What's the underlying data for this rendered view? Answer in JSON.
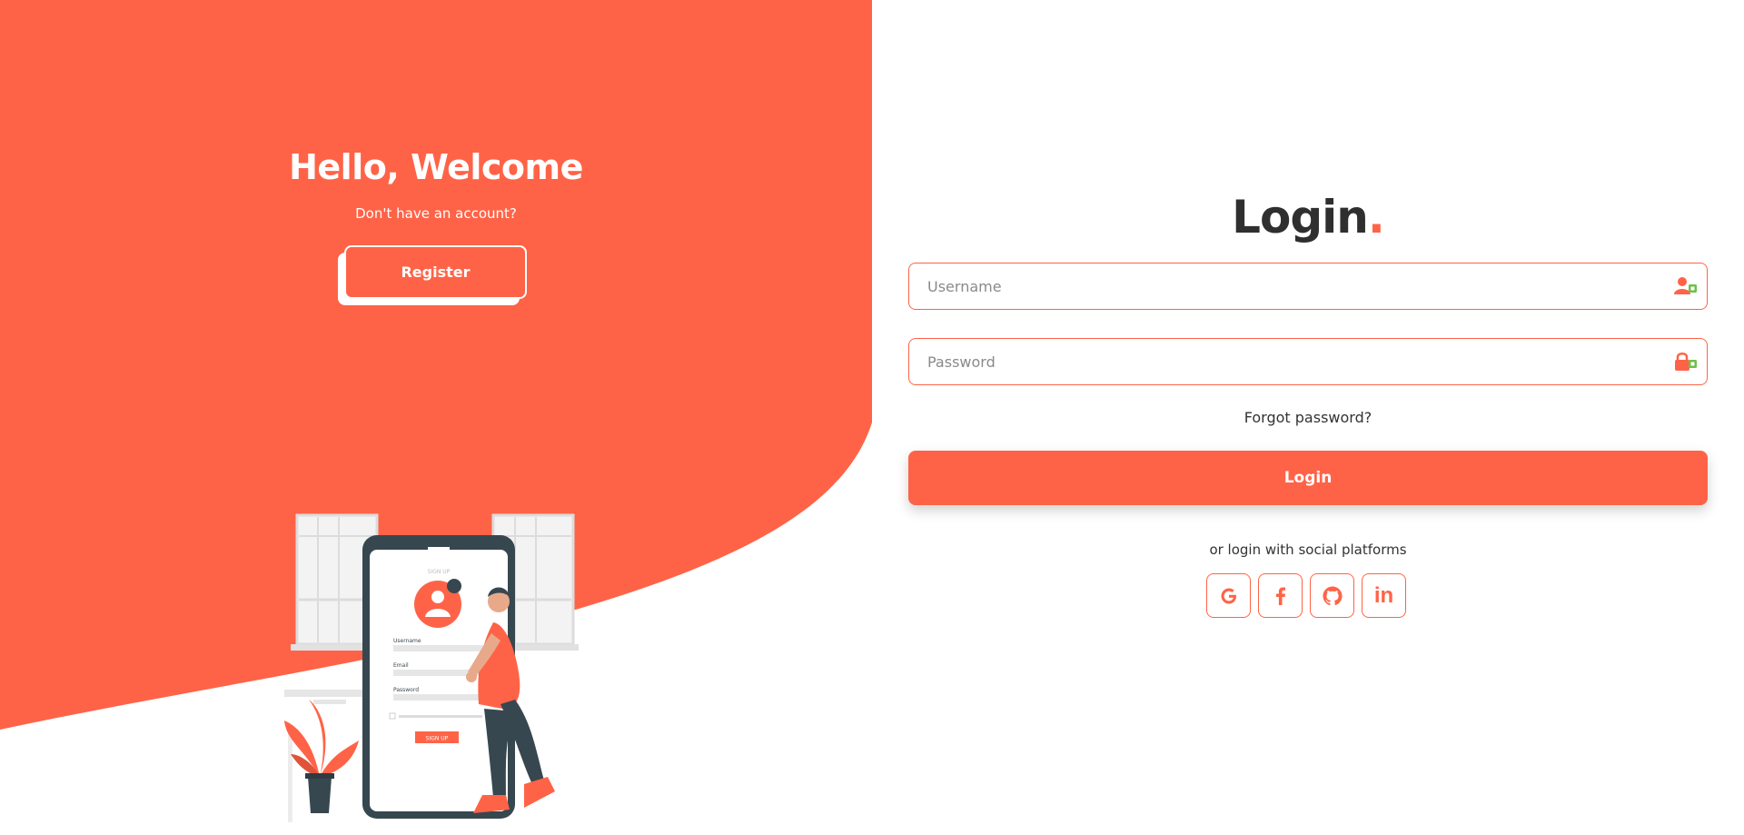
{
  "colors": {
    "accent": "#ff6347",
    "white": "#ffffff",
    "dark": "#2f2f2f"
  },
  "left": {
    "heading": "Hello, Welcome",
    "subtext": "Don't have an account?",
    "register_label": "Register",
    "illustration": {
      "phone_screen_title": "SIGN UP",
      "field_username": "Username",
      "field_email": "Email",
      "field_password": "Password",
      "phone_button": "SIGN UP"
    }
  },
  "right": {
    "title": "Login",
    "title_dot": ".",
    "username_placeholder": "Username",
    "password_placeholder": "Password",
    "forgot_label": "Forgot password?",
    "login_label": "Login",
    "social_text": "or login with social platforms",
    "social": [
      {
        "name": "google",
        "icon": "google-icon"
      },
      {
        "name": "facebook",
        "icon": "facebook-icon"
      },
      {
        "name": "github",
        "icon": "github-icon"
      },
      {
        "name": "linkedin",
        "icon": "linkedin-icon",
        "label": "in"
      }
    ]
  }
}
